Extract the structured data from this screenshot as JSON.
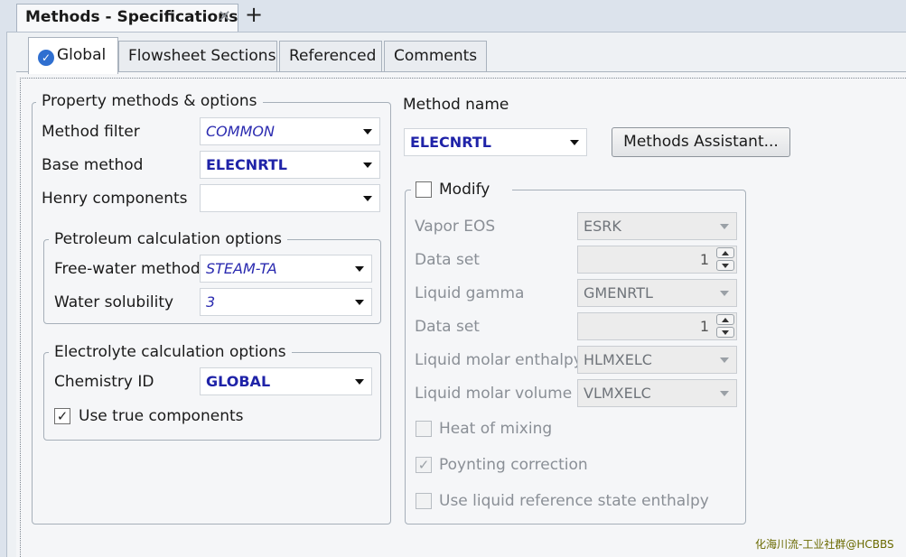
{
  "document_tab": {
    "title": "Methods - Specifications",
    "close_glyph": "✕",
    "new_tab_glyph": "+"
  },
  "tabs": [
    {
      "label": "Global",
      "icon": "check-circle-icon",
      "active": true
    },
    {
      "label": "Flowsheet Sections"
    },
    {
      "label": "Referenced"
    },
    {
      "label": "Comments"
    }
  ],
  "property_methods": {
    "title": "Property methods & options",
    "method_filter": {
      "label": "Method filter",
      "value": "COMMON"
    },
    "base_method": {
      "label": "Base method",
      "value": "ELECNRTL"
    },
    "henry_components": {
      "label": "Henry components",
      "value": ""
    },
    "petroleum": {
      "title": "Petroleum calculation options",
      "free_water_method": {
        "label": "Free-water method",
        "value": "STEAM-TA"
      },
      "water_solubility": {
        "label": "Water solubility",
        "value": "3"
      }
    },
    "electrolyte": {
      "title": "Electrolyte calculation options",
      "chemistry_id": {
        "label": "Chemistry ID",
        "value": "GLOBAL"
      },
      "use_true_components": {
        "label": "Use true components",
        "checked": true
      }
    }
  },
  "method_name": {
    "label": "Method name",
    "value": "ELECNRTL"
  },
  "methods_assistant": {
    "label": "Methods Assistant..."
  },
  "modify": {
    "label": "Modify",
    "checked": false,
    "vapor_eos": {
      "label": "Vapor EOS",
      "value": "ESRK"
    },
    "data_set_1": {
      "label": "Data set",
      "value": "1"
    },
    "liquid_gamma": {
      "label": "Liquid gamma",
      "value": "GMENRTL"
    },
    "data_set_2": {
      "label": "Data set",
      "value": "1"
    },
    "liquid_molar_enthalpy": {
      "label": "Liquid molar enthalpy",
      "value": "HLMXELC"
    },
    "liquid_molar_volume": {
      "label": "Liquid molar volume",
      "value": "VLMXELC"
    },
    "heat_of_mixing": {
      "label": "Heat of mixing",
      "checked": false
    },
    "poynting_correction": {
      "label": "Poynting correction",
      "checked": true
    },
    "liquid_reference_state": {
      "label": "Use liquid reference state enthalpy",
      "checked": false
    }
  },
  "check_glyph": "✓",
  "watermark": "化海川流-工业社群@HCBBS"
}
